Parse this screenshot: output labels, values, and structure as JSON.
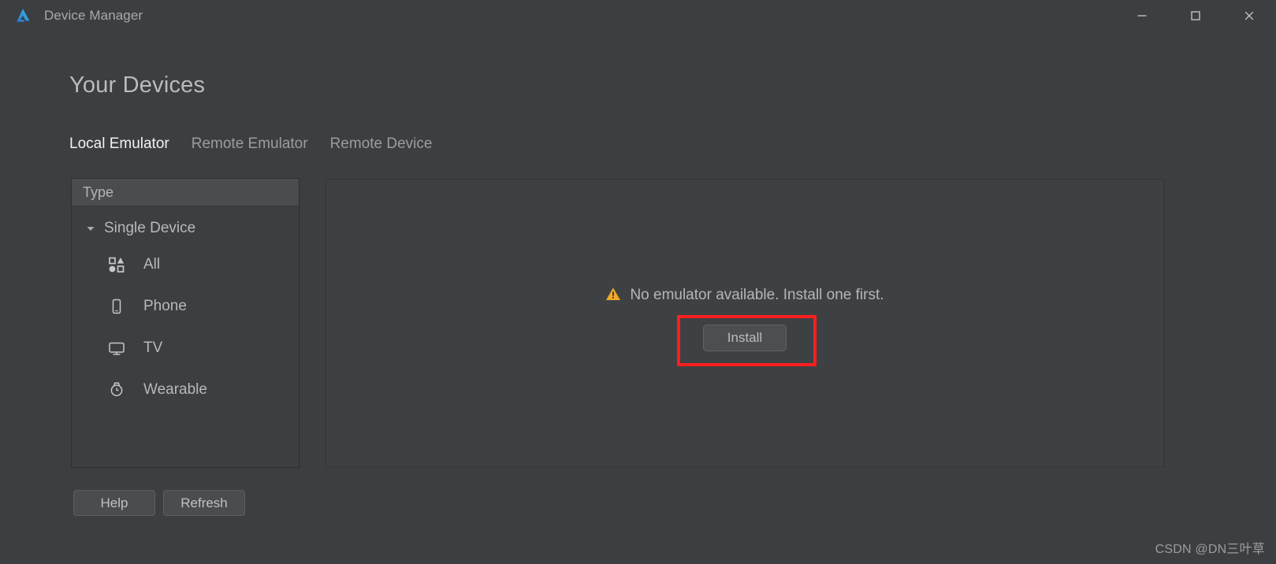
{
  "window": {
    "title": "Device Manager",
    "logo_icon": "deveco-logo-icon",
    "controls": {
      "minimize": "—",
      "maximize": "□",
      "close": "✕",
      "minimize_name": "minimize-button",
      "maximize_name": "maximize-button",
      "close_name": "close-button"
    }
  },
  "page": {
    "title": "Your Devices"
  },
  "tabs": [
    {
      "label": "Local Emulator",
      "active": true
    },
    {
      "label": "Remote Emulator",
      "active": false
    },
    {
      "label": "Remote Device",
      "active": false
    }
  ],
  "sidebar": {
    "header": "Type",
    "group": {
      "label": "Single Device",
      "expanded": true,
      "caret_icon": "caret-down-icon"
    },
    "items": [
      {
        "label": "All",
        "icon": "shapes-grid-icon"
      },
      {
        "label": "Phone",
        "icon": "phone-icon"
      },
      {
        "label": "TV",
        "icon": "tv-icon"
      },
      {
        "label": "Wearable",
        "icon": "watch-icon"
      }
    ]
  },
  "footer_buttons": [
    {
      "label": "Help",
      "name": "help-button"
    },
    {
      "label": "Refresh",
      "name": "refresh-button"
    }
  ],
  "main": {
    "warning_icon": "warning-triangle-icon",
    "empty_message": "No emulator available. Install one first.",
    "install_label": "Install",
    "highlight_color": "#ff1e1e"
  },
  "watermark": "CSDN @DN三叶草",
  "colors": {
    "window_bg": "#3c3f41",
    "panel_bg": "#3e4143",
    "header_bg": "#4a4d4f",
    "text": "#b6b8ba",
    "text_bright": "#f2f2f2",
    "warning": "#f0a828",
    "accent_logo_blue": "#2f7fd8",
    "accent_logo_cyan": "#2ec6e8"
  }
}
